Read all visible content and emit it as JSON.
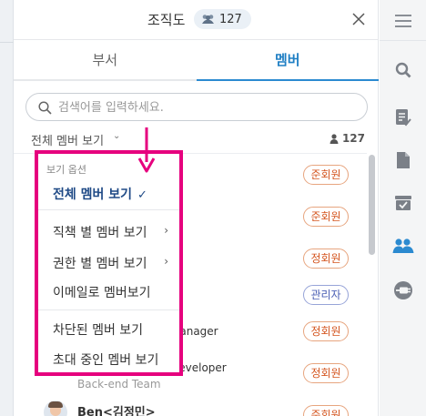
{
  "header": {
    "title": "조직도",
    "member_count": "127"
  },
  "tabs": [
    {
      "label": "부서"
    },
    {
      "label": "멤버"
    }
  ],
  "search": {
    "placeholder": "검색어를 입력하세요."
  },
  "viewbar": {
    "selected": "전체 멤버 보기",
    "chevron": "⌄",
    "total": "127"
  },
  "popup": {
    "heading": "보기 옵션",
    "items": [
      {
        "label": "전체 멤버 보기",
        "selected": true,
        "check": "✓"
      },
      {
        "label": "직책 별 멤버 보기",
        "submenu": "›"
      },
      {
        "label": "권한 별 멤버 보기",
        "submenu": "›"
      },
      {
        "label": "이메일로 멤버보기"
      },
      {
        "label": "차단된 멤버 보기"
      },
      {
        "label": "초대 중인 멤버 보기"
      }
    ]
  },
  "members": [
    {
      "role": "준회원"
    },
    {
      "role": "준회원"
    },
    {
      "role": "정회원"
    },
    {
      "role": "관리자"
    },
    {
      "role": "정회원",
      "title_partial": "Manager"
    },
    {
      "role": "정회원",
      "title_partial": "Developer",
      "dept": "Back-end Team"
    },
    {
      "role": "준회원",
      "name": "Ben<김정민>"
    }
  ],
  "rail_icons": [
    "menu-icon",
    "search-icon",
    "notes-icon",
    "file-icon",
    "inbox-icon",
    "people-icon",
    "plugin-icon"
  ],
  "colors": {
    "accent": "#2b8ad0",
    "highlight": "#e6007e",
    "member_role": "#d4551f",
    "admin_role": "#4b5fb4"
  }
}
